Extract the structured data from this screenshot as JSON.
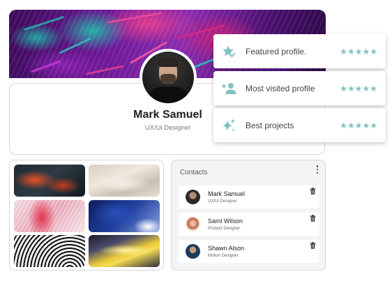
{
  "profile": {
    "name": "Mark Samuel",
    "role": "UX/Ui Designer"
  },
  "badges": [
    {
      "label": "Featured profile.",
      "icon": "star-check-icon",
      "rating": "★★★★★"
    },
    {
      "label": "Most visited profile",
      "icon": "user-star-icon",
      "rating": "★★★★★"
    },
    {
      "label": "Best projects",
      "icon": "sparkle-icon",
      "rating": "★★★★★"
    }
  ],
  "gallery": {
    "images": [
      "abstract-red-smoke",
      "beige-silk-waves",
      "pink-feather-burst",
      "blue-ink-cloud",
      "black-white-spiral",
      "yellow-light-streak"
    ]
  },
  "contacts": {
    "title": "Contacts",
    "items": [
      {
        "name": "Mark Samuel",
        "role": "UX/UI Designer"
      },
      {
        "name": "Sami Wilson",
        "role": "Product Designer"
      },
      {
        "name": "Shawn Alson",
        "role": "Motion Designer"
      }
    ]
  },
  "colors": {
    "accent": "#7ec3c1",
    "border": "#d6d6d6",
    "contacts_bg": "#f3f4f6"
  }
}
